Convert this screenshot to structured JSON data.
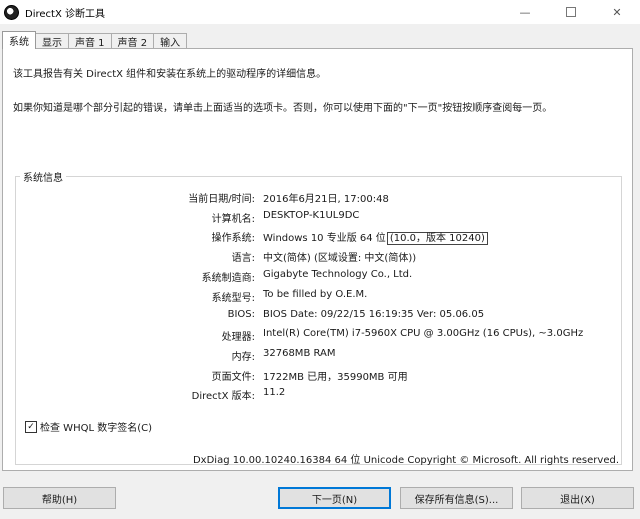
{
  "window": {
    "title": "DirectX 诊断工具",
    "icon": "directx-icon"
  },
  "tabs": [
    {
      "label": "系统",
      "active": true
    },
    {
      "label": "显示",
      "active": false
    },
    {
      "label": "声音 1",
      "active": false
    },
    {
      "label": "声音 2",
      "active": false
    },
    {
      "label": "输入",
      "active": false
    }
  ],
  "intro": {
    "line1": "该工具报告有关 DirectX 组件和安装在系统上的驱动程序的详细信息。",
    "line2": "如果你知道是哪个部分引起的错误，请单击上面适当的选项卡。否则，你可以使用下面的\"下一页\"按钮按顺序查阅每一页。"
  },
  "system_info": {
    "title": "系统信息",
    "rows": [
      {
        "label": "当前日期/时间:",
        "value": "2016年6月21日, 17:00:48"
      },
      {
        "label": "计算机名:",
        "value": "DESKTOP-K1UL9DC"
      },
      {
        "label": "操作系统:",
        "value": "Windows 10 专业版 64 位",
        "highlight": "(10.0，版本 10240)"
      },
      {
        "label": "语言:",
        "value": "中文(简体) (区域设置: 中文(简体))"
      },
      {
        "label": "系统制造商:",
        "value": "Gigabyte Technology Co., Ltd."
      },
      {
        "label": "系统型号:",
        "value": "To be filled by O.E.M."
      },
      {
        "label": "BIOS:",
        "value": "BIOS Date: 09/22/15 16:19:35 Ver: 05.06.05"
      },
      {
        "label": "处理器:",
        "value": "Intel(R) Core(TM) i7-5960X CPU @ 3.00GHz (16 CPUs), ~3.0GHz"
      },
      {
        "label": "内存:",
        "value": "32768MB RAM"
      },
      {
        "label": "页面文件:",
        "value": "1722MB 已用，35990MB 可用"
      },
      {
        "label": "DirectX 版本:",
        "value": "11.2"
      }
    ]
  },
  "whql": {
    "label": "检查 WHQL 数字签名(C)",
    "checked": true,
    "mark": "✓"
  },
  "footer": {
    "text": "DxDiag 10.00.10240.16384 64 位 Unicode  Copyright © Microsoft. All rights reserved."
  },
  "buttons": {
    "help": "帮助(H)",
    "next": "下一页(N)",
    "save": "保存所有信息(S)...",
    "exit": "退出(X)"
  },
  "window_controls": {
    "minimize": "—",
    "close": "✕"
  }
}
